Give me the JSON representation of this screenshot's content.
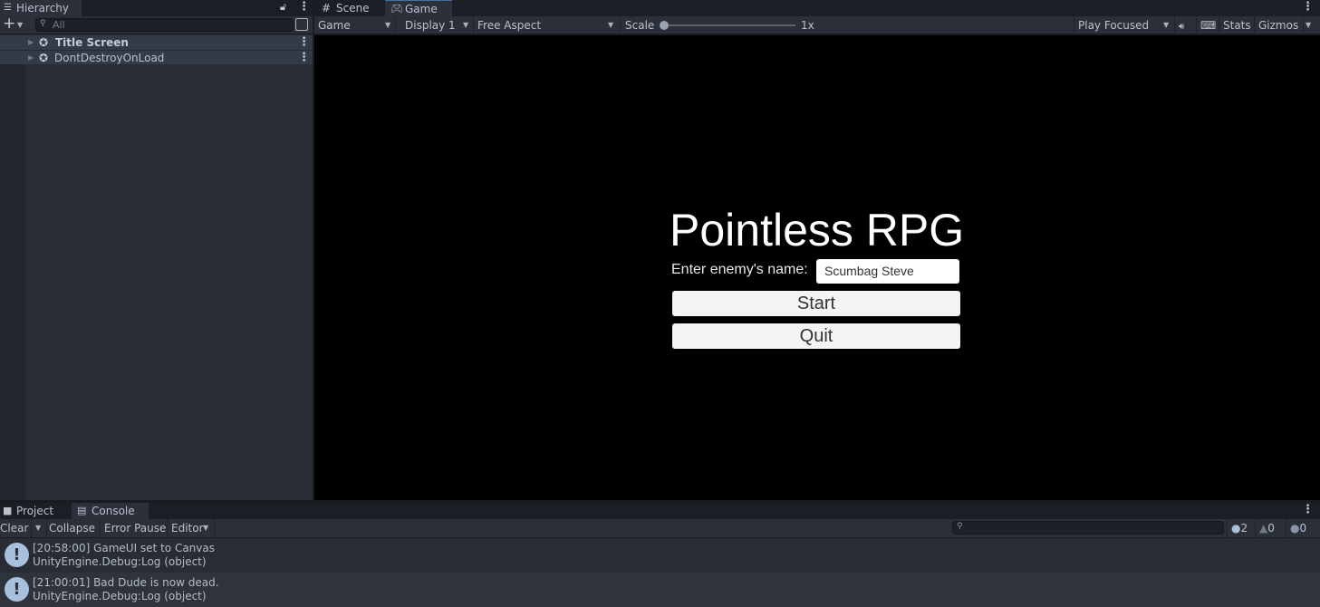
{
  "hierarchy": {
    "tab": "Hierarchy",
    "search_placeholder": "All",
    "items": [
      {
        "label": "Title Screen"
      },
      {
        "label": "DontDestroyOnLoad"
      }
    ]
  },
  "center": {
    "tabs": [
      {
        "label": "Scene"
      },
      {
        "label": "Game"
      }
    ],
    "toolbar": {
      "view": "Game",
      "display": "Display 1",
      "aspect": "Free Aspect",
      "scale_label": "Scale",
      "scale_value": "1x",
      "scale_fraction": 0,
      "play_mode": "Play Focused",
      "stats": "Stats",
      "gizmos": "Gizmos"
    }
  },
  "game": {
    "title": "Pointless RPG",
    "name_label": "Enter enemy's name:",
    "name_value": "Scumbag Steve",
    "start": "Start",
    "quit": "Quit"
  },
  "bottom": {
    "tabs": [
      {
        "label": "Project"
      },
      {
        "label": "Console"
      }
    ],
    "toolbar": {
      "clear": "Clear",
      "collapse": "Collapse",
      "error_pause": "Error Pause",
      "editor": "Editor"
    },
    "counts": {
      "info": "2",
      "warning": "0",
      "error": "0"
    },
    "logs": [
      {
        "line1": "[20:58:00] GameUI set to Canvas",
        "line2": "UnityEngine.Debug:Log (object)"
      },
      {
        "line1": "[21:00:01] Bad Dude is now dead.",
        "line2": "UnityEngine.Debug:Log (object)"
      }
    ]
  },
  "colors": {
    "accent": "#3d6fb0",
    "game_bg": "#000000",
    "info_icon": "#a9c0dc"
  }
}
